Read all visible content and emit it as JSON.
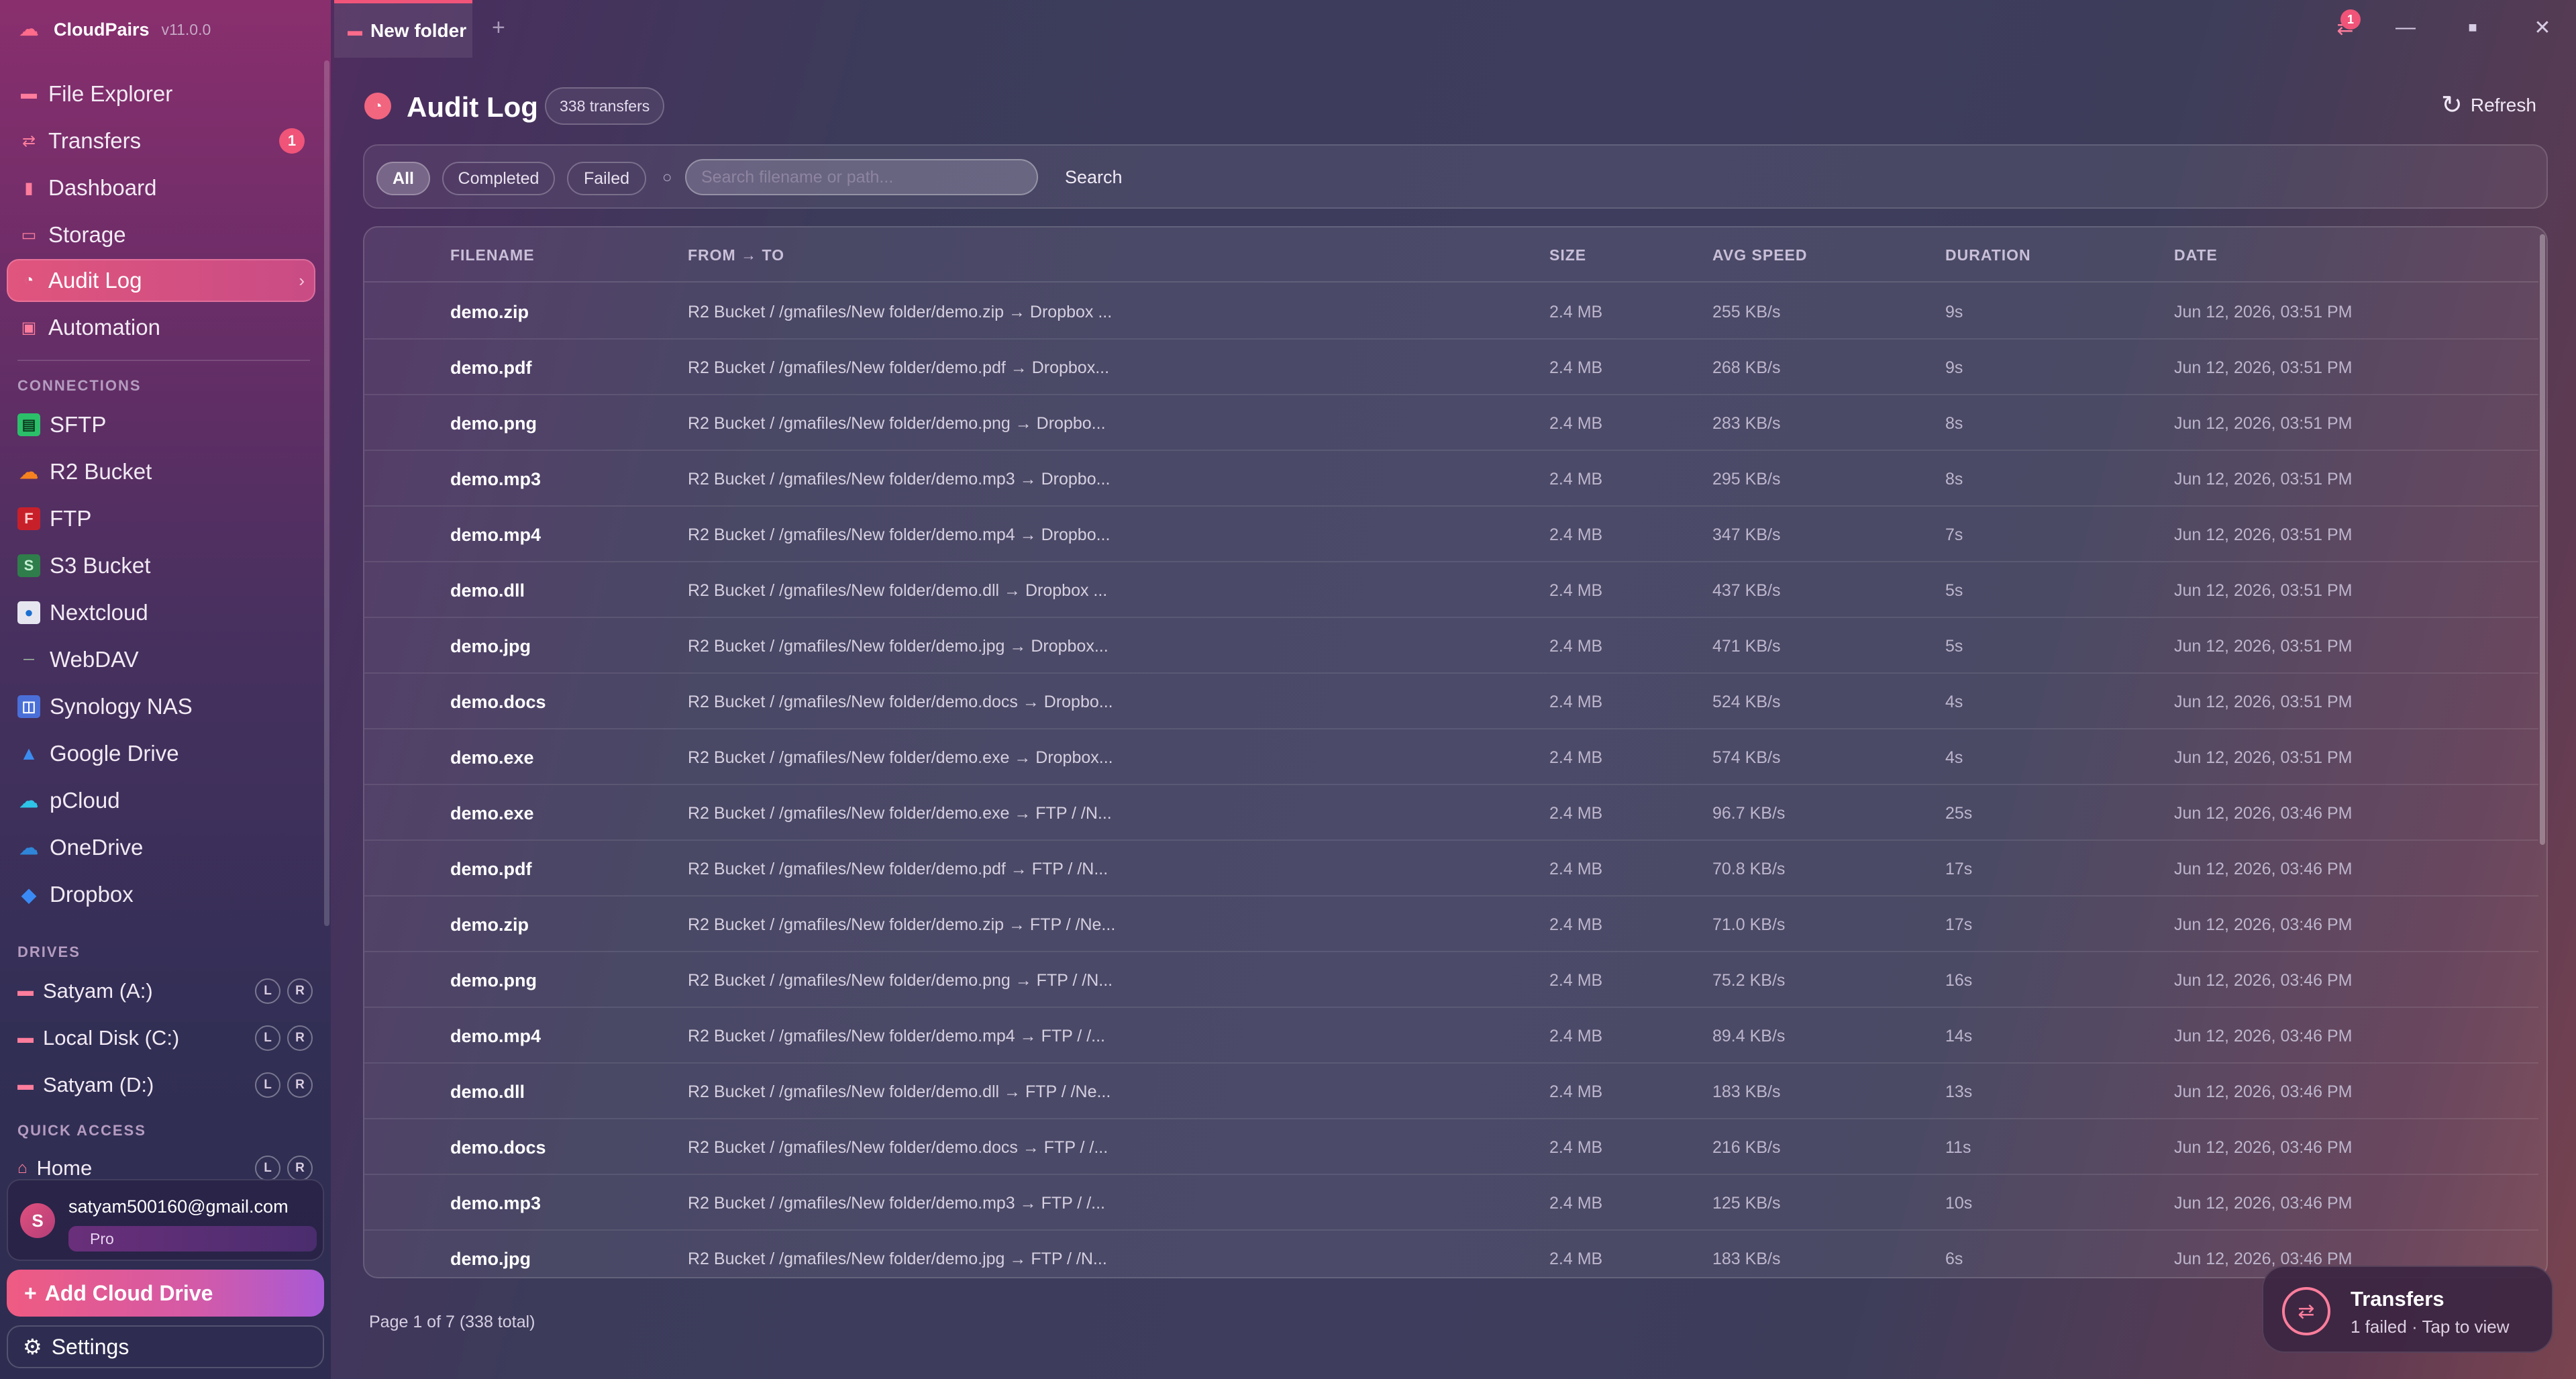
{
  "app": {
    "name": "CloudPairs",
    "version": "v11.0.0"
  },
  "tab": {
    "label": "New folder",
    "add": "+"
  },
  "window": {
    "badge": "1",
    "minimize": "—",
    "maximize": "■",
    "close": "✕"
  },
  "nav": [
    {
      "label": "File Explorer",
      "icon": "folder-icon"
    },
    {
      "label": "Transfers",
      "icon": "transfer-icon",
      "badge": "1"
    },
    {
      "label": "Dashboard",
      "icon": "dashboard-icon"
    },
    {
      "label": "Storage",
      "icon": "storage-icon"
    },
    {
      "label": "Audit Log",
      "icon": "clock-icon",
      "active": true
    },
    {
      "label": "Automation",
      "icon": "automation-icon"
    }
  ],
  "sections": {
    "connections": "CONNECTIONS",
    "drives": "DRIVES",
    "quick": "QUICK ACCESS"
  },
  "connections": [
    {
      "label": "SFTP",
      "icon": "sftp-icon"
    },
    {
      "label": "R2 Bucket",
      "icon": "cloudflare-icon"
    },
    {
      "label": "FTP",
      "icon": "ftp-icon"
    },
    {
      "label": "S3 Bucket",
      "icon": "s3-icon"
    },
    {
      "label": "Nextcloud",
      "icon": "nextcloud-icon"
    },
    {
      "label": "WebDAV",
      "icon": "webdav-icon"
    },
    {
      "label": "Synology NAS",
      "icon": "synology-icon"
    },
    {
      "label": "Google Drive",
      "icon": "google-drive-icon"
    },
    {
      "label": "pCloud",
      "icon": "pcloud-icon"
    },
    {
      "label": "OneDrive",
      "icon": "onedrive-icon"
    },
    {
      "label": "Dropbox",
      "icon": "dropbox-icon"
    }
  ],
  "drives": [
    {
      "label": "Satyam (A:)",
      "l": "L",
      "r": "R"
    },
    {
      "label": "Local Disk (C:)",
      "l": "L",
      "r": "R"
    },
    {
      "label": "Satyam (D:)",
      "l": "L",
      "r": "R"
    }
  ],
  "quick": [
    {
      "label": "Home",
      "l": "L",
      "r": "R"
    }
  ],
  "user": {
    "initial": "S",
    "email": "satyam500160@gmail.com",
    "plan": "Pro"
  },
  "buttons": {
    "add": "Add Cloud Drive",
    "settings": "Settings",
    "refresh": "Refresh",
    "search": "Search"
  },
  "page": {
    "title": "Audit Log",
    "count": "338 transfers"
  },
  "filters": {
    "all": "All",
    "completed": "Completed",
    "failed": "Failed",
    "placeholder": "Search filename or path..."
  },
  "columns": {
    "filename": "FILENAME",
    "fromto": "FROM → TO",
    "size": "SIZE",
    "speed": "AVG SPEED",
    "duration": "DURATION",
    "date": "DATE"
  },
  "rows": [
    {
      "file": "demo.zip",
      "path": "R2 Bucket / /gmafiles/New folder/demo.zip → Dropbox ...",
      "size": "2.4 MB",
      "speed": "255 KB/s",
      "duration": "9s",
      "date": "Jun 12, 2026, 03:51 PM"
    },
    {
      "file": "demo.pdf",
      "path": "R2 Bucket / /gmafiles/New folder/demo.pdf → Dropbox...",
      "size": "2.4 MB",
      "speed": "268 KB/s",
      "duration": "9s",
      "date": "Jun 12, 2026, 03:51 PM"
    },
    {
      "file": "demo.png",
      "path": "R2 Bucket / /gmafiles/New folder/demo.png → Dropbo...",
      "size": "2.4 MB",
      "speed": "283 KB/s",
      "duration": "8s",
      "date": "Jun 12, 2026, 03:51 PM"
    },
    {
      "file": "demo.mp3",
      "path": "R2 Bucket / /gmafiles/New folder/demo.mp3 → Dropbo...",
      "size": "2.4 MB",
      "speed": "295 KB/s",
      "duration": "8s",
      "date": "Jun 12, 2026, 03:51 PM"
    },
    {
      "file": "demo.mp4",
      "path": "R2 Bucket / /gmafiles/New folder/demo.mp4 → Dropbo...",
      "size": "2.4 MB",
      "speed": "347 KB/s",
      "duration": "7s",
      "date": "Jun 12, 2026, 03:51 PM"
    },
    {
      "file": "demo.dll",
      "path": "R2 Bucket / /gmafiles/New folder/demo.dll → Dropbox ...",
      "size": "2.4 MB",
      "speed": "437 KB/s",
      "duration": "5s",
      "date": "Jun 12, 2026, 03:51 PM"
    },
    {
      "file": "demo.jpg",
      "path": "R2 Bucket / /gmafiles/New folder/demo.jpg → Dropbox...",
      "size": "2.4 MB",
      "speed": "471 KB/s",
      "duration": "5s",
      "date": "Jun 12, 2026, 03:51 PM"
    },
    {
      "file": "demo.docs",
      "path": "R2 Bucket / /gmafiles/New folder/demo.docs → Dropbo...",
      "size": "2.4 MB",
      "speed": "524 KB/s",
      "duration": "4s",
      "date": "Jun 12, 2026, 03:51 PM"
    },
    {
      "file": "demo.exe",
      "path": "R2 Bucket / /gmafiles/New folder/demo.exe → Dropbox...",
      "size": "2.4 MB",
      "speed": "574 KB/s",
      "duration": "4s",
      "date": "Jun 12, 2026, 03:51 PM"
    },
    {
      "file": "demo.exe",
      "path": "R2 Bucket / /gmafiles/New folder/demo.exe → FTP / /N...",
      "size": "2.4 MB",
      "speed": "96.7 KB/s",
      "duration": "25s",
      "date": "Jun 12, 2026, 03:46 PM"
    },
    {
      "file": "demo.pdf",
      "path": "R2 Bucket / /gmafiles/New folder/demo.pdf → FTP / /N...",
      "size": "2.4 MB",
      "speed": "70.8 KB/s",
      "duration": "17s",
      "date": "Jun 12, 2026, 03:46 PM"
    },
    {
      "file": "demo.zip",
      "path": "R2 Bucket / /gmafiles/New folder/demo.zip → FTP / /Ne...",
      "size": "2.4 MB",
      "speed": "71.0 KB/s",
      "duration": "17s",
      "date": "Jun 12, 2026, 03:46 PM"
    },
    {
      "file": "demo.png",
      "path": "R2 Bucket / /gmafiles/New folder/demo.png → FTP / /N...",
      "size": "2.4 MB",
      "speed": "75.2 KB/s",
      "duration": "16s",
      "date": "Jun 12, 2026, 03:46 PM"
    },
    {
      "file": "demo.mp4",
      "path": "R2 Bucket / /gmafiles/New folder/demo.mp4 → FTP / /...",
      "size": "2.4 MB",
      "speed": "89.4 KB/s",
      "duration": "14s",
      "date": "Jun 12, 2026, 03:46 PM"
    },
    {
      "file": "demo.dll",
      "path": "R2 Bucket / /gmafiles/New folder/demo.dll → FTP / /Ne...",
      "size": "2.4 MB",
      "speed": "183 KB/s",
      "duration": "13s",
      "date": "Jun 12, 2026, 03:46 PM"
    },
    {
      "file": "demo.docs",
      "path": "R2 Bucket / /gmafiles/New folder/demo.docs → FTP / /...",
      "size": "2.4 MB",
      "speed": "216 KB/s",
      "duration": "11s",
      "date": "Jun 12, 2026, 03:46 PM"
    },
    {
      "file": "demo.mp3",
      "path": "R2 Bucket / /gmafiles/New folder/demo.mp3 → FTP / /...",
      "size": "2.4 MB",
      "speed": "125 KB/s",
      "duration": "10s",
      "date": "Jun 12, 2026, 03:46 PM"
    },
    {
      "file": "demo.jpg",
      "path": "R2 Bucket / /gmafiles/New folder/demo.jpg → FTP / /N...",
      "size": "2.4 MB",
      "speed": "183 KB/s",
      "duration": "6s",
      "date": "Jun 12, 2026, 03:46 PM"
    }
  ],
  "pager": "Page 1 of 7 (338 total)",
  "toast": {
    "title": "Transfers",
    "subtitle": "1 failed · Tap to view"
  },
  "colors": {
    "accent": "#f05478",
    "sidebar_top": "#8a2f6e",
    "background": "#3d3d5a"
  }
}
